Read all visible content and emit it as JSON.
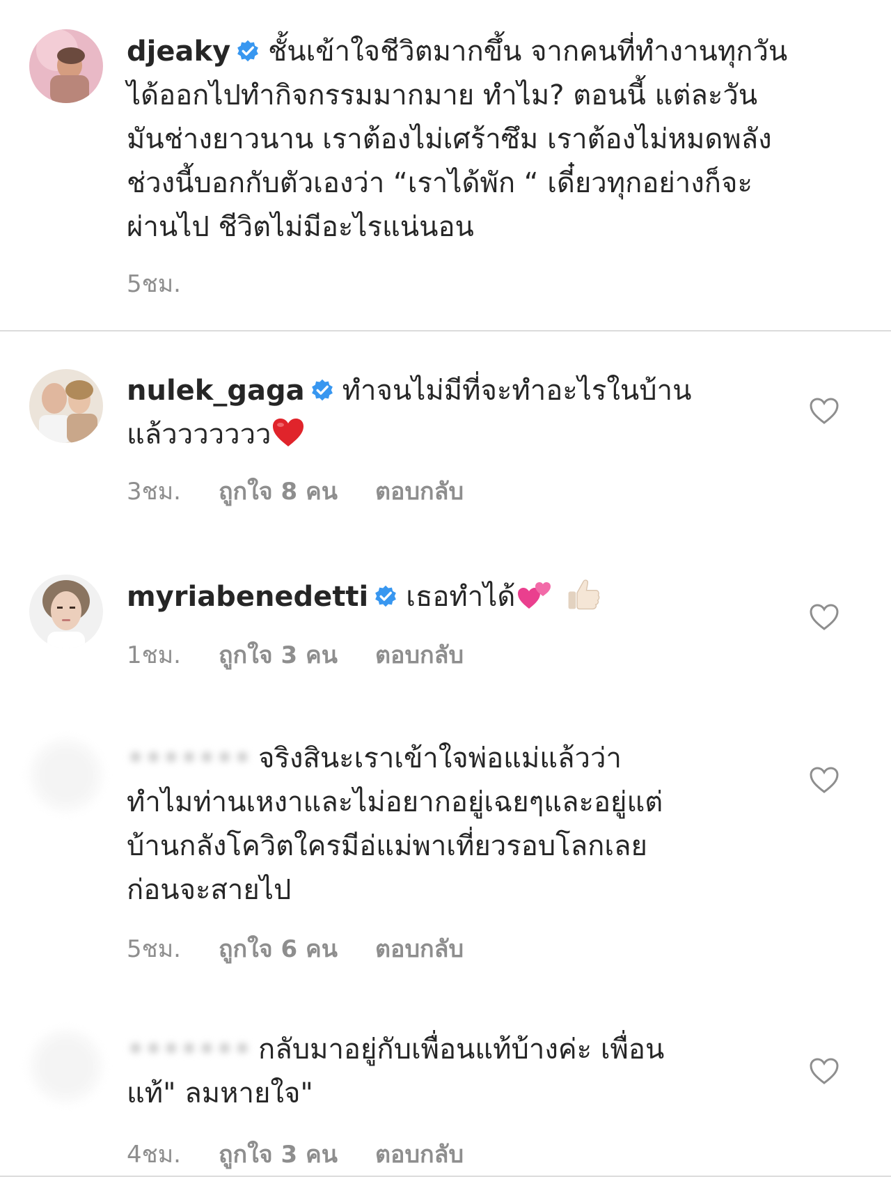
{
  "comments": [
    {
      "username": "djeaky",
      "verified": true,
      "lines": [
        "ชั้นเข้าใจชีวิตมากขึ้น จากคนที่ทำงานทุกวัน",
        "ได้ออกไปทำกิจกรรมมากมาย ทำไม? ตอนนี้ แต่ละวัน",
        "มันช่างยาวนาน เราต้องไม่เศร้าซึม เราต้องไม่หมดพลัง",
        "ช่วงนี้บอกกับตัวเองว่า “เราได้พัก “ เดี๋ยวทุกอย่างก็จะ",
        "ผ่านไป ชีวิตไม่มีอะไรแน่นอน"
      ],
      "time": "5ชม."
    },
    {
      "username": "nulek_gaga",
      "verified": true,
      "line1": "ทำจนไม่มีที่จะทำอะไรในบ้าน",
      "line2": "แล้ววววววว",
      "emoji": "red-heart",
      "time": "3ชม.",
      "likes": "ถูกใจ 8 คน",
      "reply": "ตอบกลับ"
    },
    {
      "username": "myriabenedetti",
      "verified": true,
      "line1": "เธอทำได้",
      "emoji": [
        "two-hearts",
        "thumbs-up"
      ],
      "time": "1ชม.",
      "likes": "ถูกใจ 3 คน",
      "reply": "ตอบกลับ"
    },
    {
      "username": "•••••••",
      "lines": [
        "จริงสินะเราเข้าใจพ่อแม่แล้วว่า",
        "ทำไมท่านเหงาและไม่อยากอยู่เฉยๆและอยู่แต่",
        "บ้านกลังโควิตใครมีอ่แม่พาเที่ยวรอบโลกเลย",
        "ก่อนจะสายไป"
      ],
      "time": "5ชม.",
      "likes": "ถูกใจ 6 คน",
      "reply": "ตอบกลับ"
    },
    {
      "username": "•••••••",
      "lines": [
        "กลับมาอยู่กับเพื่อนแท้บ้างค่ะ เพื่อน",
        "แท้\" ลมหายใจ\""
      ],
      "time": "4ชม.",
      "likes": "ถูกใจ 3 คน",
      "reply": "ตอบกลับ"
    }
  ],
  "colors": {
    "text": "#262626",
    "meta": "#8e8e8e",
    "verified": "#3897f0",
    "divider": "#dbdbdb"
  }
}
